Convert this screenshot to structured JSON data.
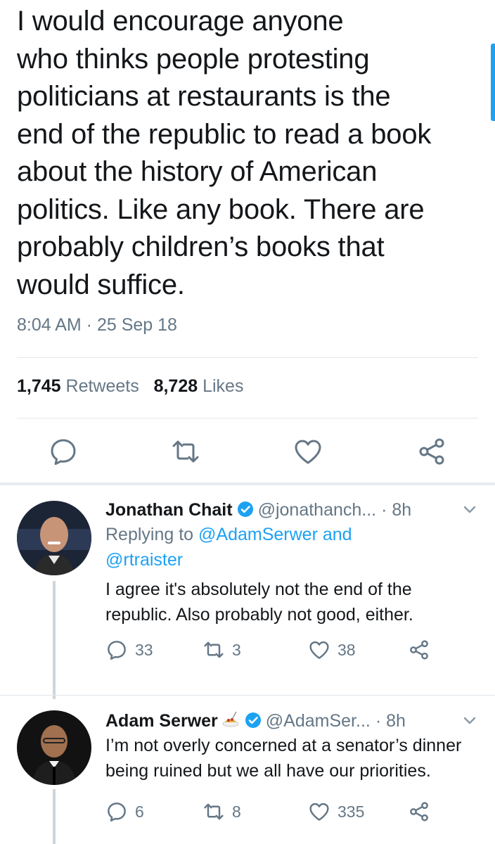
{
  "tweet": {
    "text": "I would encourage anyone\nwho thinks people protesting\npoliticians at restaurants is the\nend of the republic to read a book\nabout the history of American\npolitics. Like any book. There are\nprobably children’s books that\nwould suffice.",
    "timestamp": "8:04 AM · 25 Sep 18",
    "retweets_count": "1,745",
    "retweets_label": "Retweets",
    "likes_count": "8,728",
    "likes_label": "Likes"
  },
  "icons": [
    "reply-icon",
    "retweet-icon",
    "like-icon",
    "share-icon",
    "verified-icon",
    "chevron-down-icon"
  ],
  "colors": {
    "accent": "#1da1f2",
    "secondary_text": "#657786",
    "divider": "#e1e8ed"
  },
  "replies": [
    {
      "name": "Jonathan Chait",
      "handle": "@jonathanch...",
      "time": "· 8h",
      "replying_prefix": "Replying to ",
      "replying_to_1": "@AdamSerwer and",
      "replying_to_2": "@rtraister",
      "text": "I agree it's absolutely not the end of the republic. Also probably not good, either.",
      "reply_count": "33",
      "retweet_count": "3",
      "like_count": "38"
    },
    {
      "name": "Adam Serwer",
      "handle": "@AdamSer...",
      "time": "· 8h",
      "text": "I’m not overly concerned at a senator’s dinner being ruined but we all have our priorities.",
      "reply_count": "6",
      "retweet_count": "8",
      "like_count": "335"
    }
  ]
}
